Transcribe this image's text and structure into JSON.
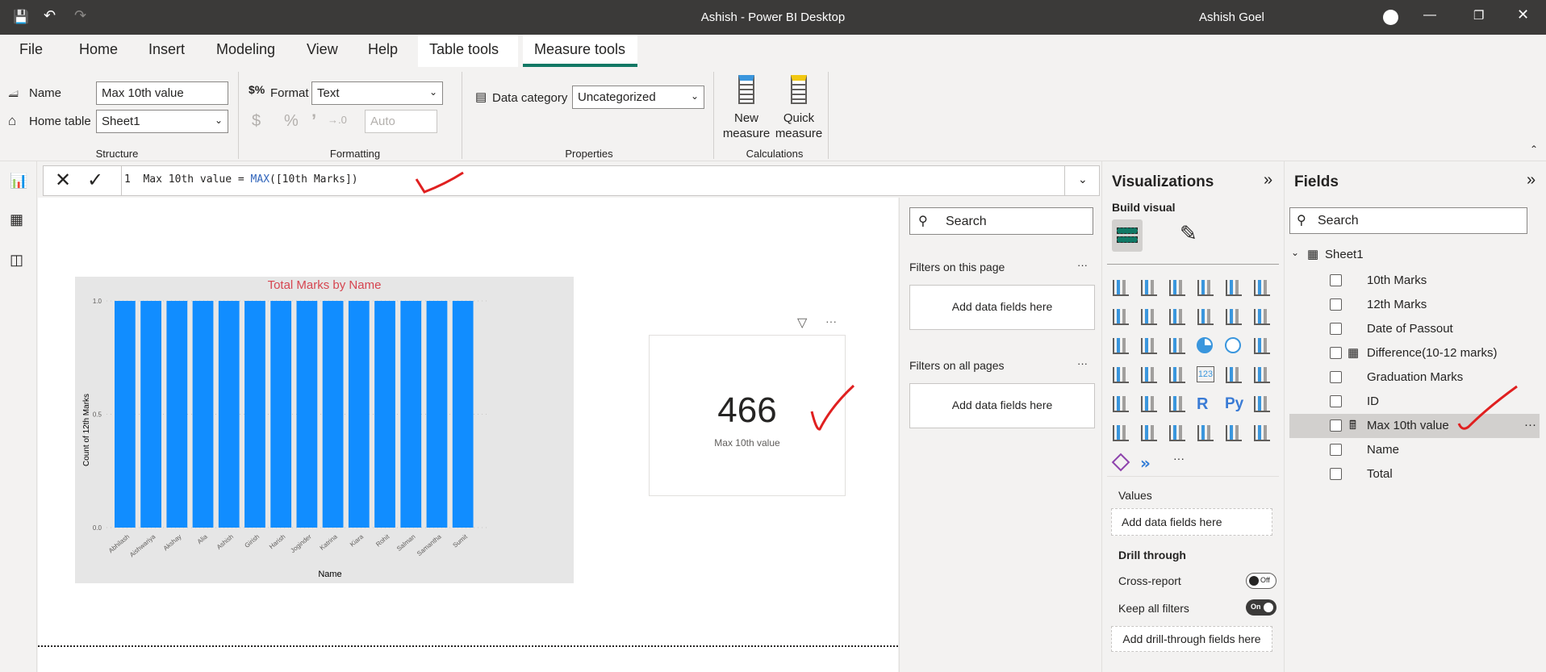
{
  "window": {
    "title": "Ashish - Power BI Desktop",
    "user": "Ashish Goel"
  },
  "tabs": [
    "File",
    "Home",
    "Insert",
    "Modeling",
    "View",
    "Help",
    "Table tools",
    "Measure tools"
  ],
  "ribbon": {
    "structure": {
      "name_label": "Name",
      "name_value": "Max 10th value",
      "home_table_label": "Home table",
      "home_table_value": "Sheet1",
      "group": "Structure"
    },
    "formatting": {
      "format_label": "Format",
      "format_value": "Text",
      "decimal_value": "Auto",
      "group": "Formatting",
      "currency": "$",
      "percent": "%",
      "comma": "’"
    },
    "properties": {
      "data_category_label": "Data category",
      "data_category_value": "Uncategorized",
      "group": "Properties"
    },
    "calculations": {
      "new_measure": [
        "New",
        "measure"
      ],
      "quick_measure": [
        "Quick",
        "measure"
      ],
      "group": "Calculations"
    }
  },
  "formula": {
    "line": "1",
    "text_pre": "Max 10th value = ",
    "func": "MAX",
    "text_post": "([10th Marks])"
  },
  "card": {
    "value": "466",
    "label": "Max 10th value"
  },
  "chart_data": {
    "type": "bar",
    "title": "Total Marks by Name",
    "xlabel": "Name",
    "ylabel": "Count of 12th Marks",
    "categories": [
      "Abhilash",
      "Aishwariya",
      "Akshay",
      "Alia",
      "Ashish",
      "Girish",
      "Harish",
      "Joginder",
      "Katrina",
      "Kiara",
      "Rohit",
      "Salman",
      "Samantha",
      "Sumit"
    ],
    "values": [
      1,
      1,
      1,
      1,
      1,
      1,
      1,
      1,
      1,
      1,
      1,
      1,
      1,
      1
    ],
    "ylim": [
      0,
      1
    ],
    "yticks": [
      "0.0",
      "0.5",
      "1.0"
    ],
    "grid": true,
    "colors": {
      "bar": "#118dff",
      "title": "#d64550",
      "background": "#e6e6e6"
    }
  },
  "filters": {
    "search_placeholder": "Search",
    "on_page": "Filters on this page",
    "on_all": "Filters on all pages",
    "add": "Add data fields here",
    "more": "···"
  },
  "visualizations": {
    "title": "Visualizations",
    "build": "Build visual",
    "values_label": "Values",
    "values_add": "Add data fields here",
    "drill": "Drill through",
    "cross": "Cross-report",
    "cross_state": "Off",
    "keep": "Keep all filters",
    "keep_state": "On",
    "drill_add": "Add drill-through fields here",
    "more": "···",
    "r": "R",
    "py": "Py",
    "n123": "123"
  },
  "fields": {
    "title": "Fields",
    "search_placeholder": "Search",
    "table": "Sheet1",
    "items": [
      "10th Marks",
      "12th Marks",
      "Date of Passout",
      "Difference(10-12 marks)",
      "Graduation Marks",
      "ID",
      "Max 10th value",
      "Name",
      "Total"
    ],
    "selected": "Max 10th value",
    "more": "···"
  }
}
